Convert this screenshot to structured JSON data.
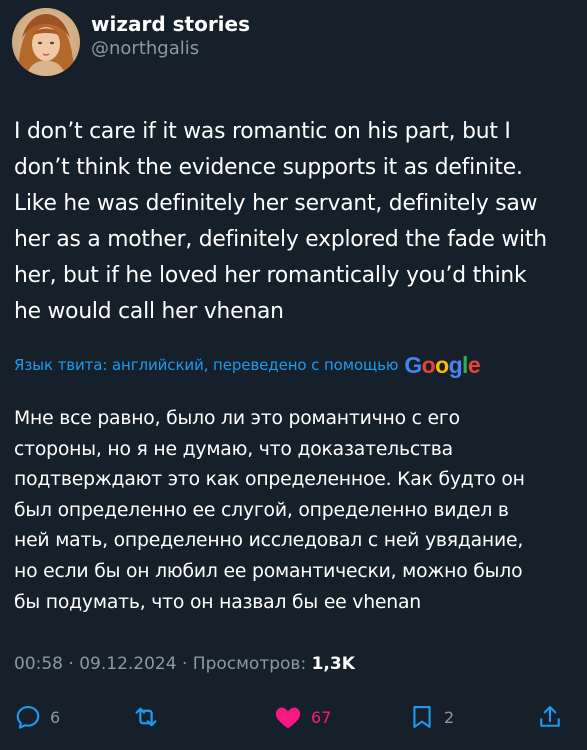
{
  "author": {
    "display_name": "wizard stories",
    "handle": "@northgalis",
    "avatar_icon": "avatar-portrait"
  },
  "tweet": {
    "text": "I don’t care if it was romantic on his part, but I\ndon’t think the evidence supports it as definite.\nLike he was definitely her servant, definitely saw\nher as a mother, definitely explored the fade with\nher, but if he loved her romantically you’d think\nhe would call her vhenan"
  },
  "translation": {
    "note": "Язык твита: английский, переведено с помощью",
    "provider": "Google",
    "text": "Мне все равно, было ли это романтично с его\nстороны, но я не думаю, что доказательства\nподтверждают это как определенное. Как будто он\nбыл определенно ее слугой, определенно видел в\nней мать, определенно исследовал с ней увядание,\nно если бы он любил ее романтически, можно было\nбы подумать, что он назвал бы ее vhenan"
  },
  "meta": {
    "time": "00:58",
    "separator": "·",
    "date": "09.12.2024",
    "views_label": "Просмотров:",
    "views_count": "1,3K"
  },
  "actions": {
    "reply": {
      "icon": "reply-icon",
      "count": "6"
    },
    "retweet": {
      "icon": "retweet-icon",
      "count": ""
    },
    "like": {
      "icon": "heart-icon",
      "count": "67",
      "liked": true
    },
    "bookmark": {
      "icon": "bookmark-icon",
      "count": "2"
    },
    "share": {
      "icon": "share-icon",
      "count": ""
    }
  },
  "colors": {
    "background": "#15202b",
    "text": "#ffffff",
    "secondary_text": "#8b98a5",
    "link": "#1d9bf0",
    "like": "#f91880"
  }
}
